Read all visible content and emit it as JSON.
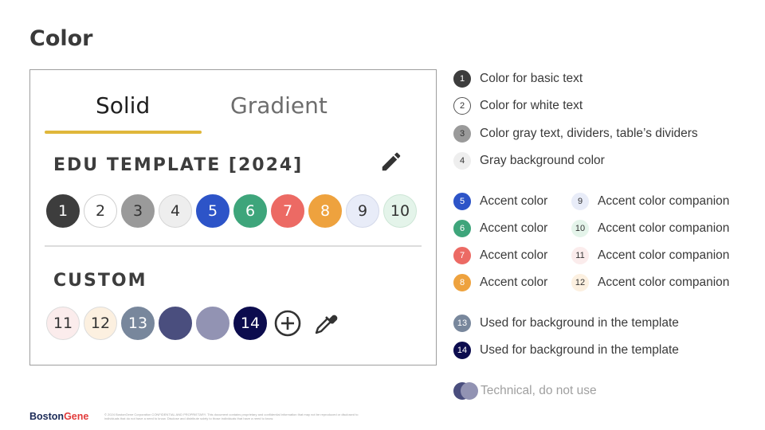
{
  "page": {
    "title": "Color"
  },
  "panel": {
    "tabs": [
      {
        "label": "Solid",
        "active": true
      },
      {
        "label": "Gradient",
        "active": false
      }
    ],
    "accent_underline_color": "#e0b73b",
    "edu_section": {
      "title": "EDU TEMPLATE [2024]",
      "edit_icon": "pencil-icon",
      "swatches": [
        {
          "label": "1",
          "bg": "#3d3d3d",
          "fg": "#ffffff",
          "border": "#3d3d3d"
        },
        {
          "label": "2",
          "bg": "#ffffff",
          "fg": "#333333",
          "border": "#cfcfcf"
        },
        {
          "label": "3",
          "bg": "#9a9a9a",
          "fg": "#333333",
          "border": "#9a9a9a"
        },
        {
          "label": "4",
          "bg": "#eeeeee",
          "fg": "#333333",
          "border": "#d6d6d6"
        },
        {
          "label": "5",
          "bg": "#2d54c8",
          "fg": "#ffffff",
          "border": "#2d54c8"
        },
        {
          "label": "6",
          "bg": "#3ea57b",
          "fg": "#ffffff",
          "border": "#3ea57b"
        },
        {
          "label": "7",
          "bg": "#ec6a64",
          "fg": "#ffffff",
          "border": "#ec6a64"
        },
        {
          "label": "8",
          "bg": "#eea23e",
          "fg": "#ffffff",
          "border": "#eea23e"
        },
        {
          "label": "9",
          "bg": "#e8ecf8",
          "fg": "#333333",
          "border": "#d4d9ea"
        },
        {
          "label": "10",
          "bg": "#e4f4ea",
          "fg": "#333333",
          "border": "#cde6d6"
        }
      ]
    },
    "custom_section": {
      "title": "CUSTOM",
      "swatches": [
        {
          "label": "11",
          "bg": "#fbecec",
          "fg": "#333333",
          "border": "#dcdcdc"
        },
        {
          "label": "12",
          "bg": "#fcf0e0",
          "fg": "#333333",
          "border": "#dcdcdc"
        },
        {
          "label": "13",
          "bg": "#78879c",
          "fg": "#ffffff",
          "border": "#78879c"
        },
        {
          "label": "",
          "bg": "#4a4e7e",
          "fg": "#ffffff",
          "border": "#4a4e7e"
        },
        {
          "label": "",
          "bg": "#9293b3",
          "fg": "#ffffff",
          "border": "#9293b3"
        },
        {
          "label": "14",
          "bg": "#0c0c4e",
          "fg": "#ffffff",
          "border": "#0c0c4e"
        }
      ],
      "add_icon": "plus-circle-icon",
      "picker_icon": "eyedropper-icon"
    }
  },
  "legend": {
    "basic": [
      {
        "num": "1",
        "text": "Color for basic text",
        "bg": "#3d3d3d",
        "fg": "#ffffff",
        "border": "#3d3d3d"
      },
      {
        "num": "2",
        "text": "Color for white text",
        "bg": "#ffffff",
        "fg": "#333333",
        "border": "#555555"
      },
      {
        "num": "3",
        "text": "Color gray text, dividers, table’s dividers",
        "bg": "#9a9a9a",
        "fg": "#333333",
        "border": "#9a9a9a"
      },
      {
        "num": "4",
        "text": "Gray background color",
        "bg": "#eeeeee",
        "fg": "#333333",
        "border": "#eeeeee"
      }
    ],
    "accents": [
      {
        "num": "5",
        "text": "Accent color",
        "bg": "#2d54c8",
        "fg": "#ffffff",
        "border": "#2d54c8"
      },
      {
        "num": "6",
        "text": "Accent color",
        "bg": "#3ea57b",
        "fg": "#ffffff",
        "border": "#3ea57b"
      },
      {
        "num": "7",
        "text": "Accent color",
        "bg": "#ec6a64",
        "fg": "#ffffff",
        "border": "#ec6a64"
      },
      {
        "num": "8",
        "text": "Accent color",
        "bg": "#eea23e",
        "fg": "#ffffff",
        "border": "#eea23e"
      }
    ],
    "companions": [
      {
        "num": "9",
        "text": "Accent color companion",
        "bg": "#e8ecf8",
        "fg": "#333333",
        "border": "#e8ecf8"
      },
      {
        "num": "10",
        "text": "Accent color companion",
        "bg": "#e4f4ea",
        "fg": "#333333",
        "border": "#e4f4ea"
      },
      {
        "num": "11",
        "text": "Accent color companion",
        "bg": "#fbecec",
        "fg": "#333333",
        "border": "#fbecec"
      },
      {
        "num": "12",
        "text": "Accent color companion",
        "bg": "#fcf0e0",
        "fg": "#333333",
        "border": "#fcf0e0"
      }
    ],
    "backgrounds": [
      {
        "num": "13",
        "text": "Used for background in the template",
        "bg": "#78879c",
        "fg": "#ffffff",
        "border": "#78879c"
      },
      {
        "num": "14",
        "text": "Used for background in the template",
        "bg": "#0c0c4e",
        "fg": "#ffffff",
        "border": "#0c0c4e"
      }
    ],
    "technical": {
      "text": "Technical, do not use",
      "colors": [
        "#4a4e7e",
        "#9293b3"
      ]
    }
  },
  "footer": {
    "brand_part1": "Boston",
    "brand_part2": "Gene",
    "fine_print": "© 2024 BostonGene Corporation CONFIDENTIAL AND PROPRIETARY. This document contains proprietary and confidential information that may not be reproduced or disclosed to individuals that do not have a need to know. Disclose and distribute solely to those individuals that have a need to know."
  }
}
